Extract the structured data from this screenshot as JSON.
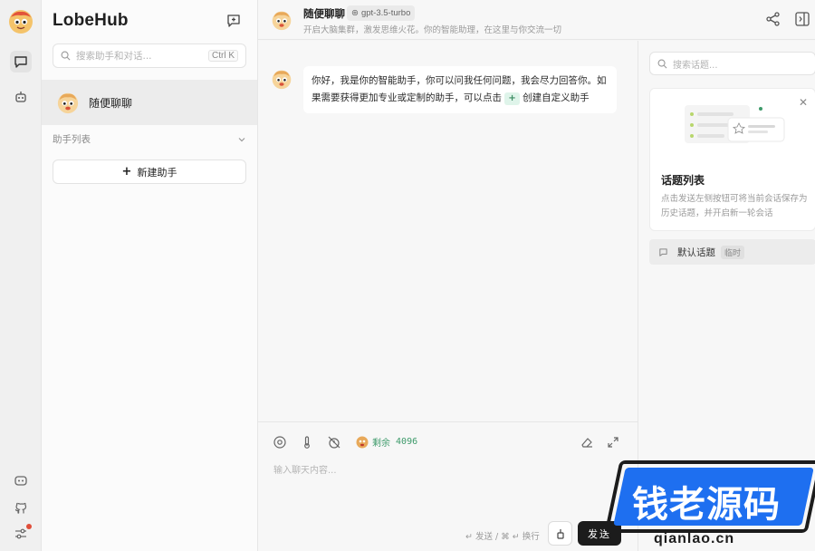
{
  "sidebar": {
    "brand": "LobeHub",
    "search_placeholder": "搜索助手和对话...",
    "search_shortcut": "Ctrl K",
    "sessions": [
      {
        "name": "随便聊聊"
      }
    ],
    "group_label": "助手列表",
    "add_agent_label": "新建助手"
  },
  "header": {
    "title": "随便聊聊",
    "model": "gpt-3.5-turbo",
    "description": "开启大脑集群，激发思维火花。你的智能助理，在这里与你交流一切"
  },
  "chat": {
    "message_before": "你好，我是你的智能助手，你可以问我任何问题，我会尽力回答你。如果需要获得更加专业或定制的助手，可以点击",
    "plus_chip": "+",
    "message_after": "创建自定义助手"
  },
  "input": {
    "tokens_label": "剩余",
    "tokens_value": "4096",
    "placeholder": "输入聊天内容...",
    "hint": "↵ 发送 / ⌘ ↵ 换行",
    "send_label": "发送"
  },
  "topics": {
    "search_placeholder": "搜索话题...",
    "tip_title": "话题列表",
    "tip_body": "点击发送左侧按钮可将当前会话保存为历史话题，并开启新一轮会话",
    "items": [
      {
        "label": "默认话题",
        "tag": "临时"
      }
    ]
  },
  "watermark": {
    "text": "钱老源码",
    "url": "qianlao.cn"
  },
  "colors": {
    "accent_green": "#3d9a6a",
    "send_button": "#1c1c1c",
    "watermark_blue": "#1e6ff0"
  }
}
